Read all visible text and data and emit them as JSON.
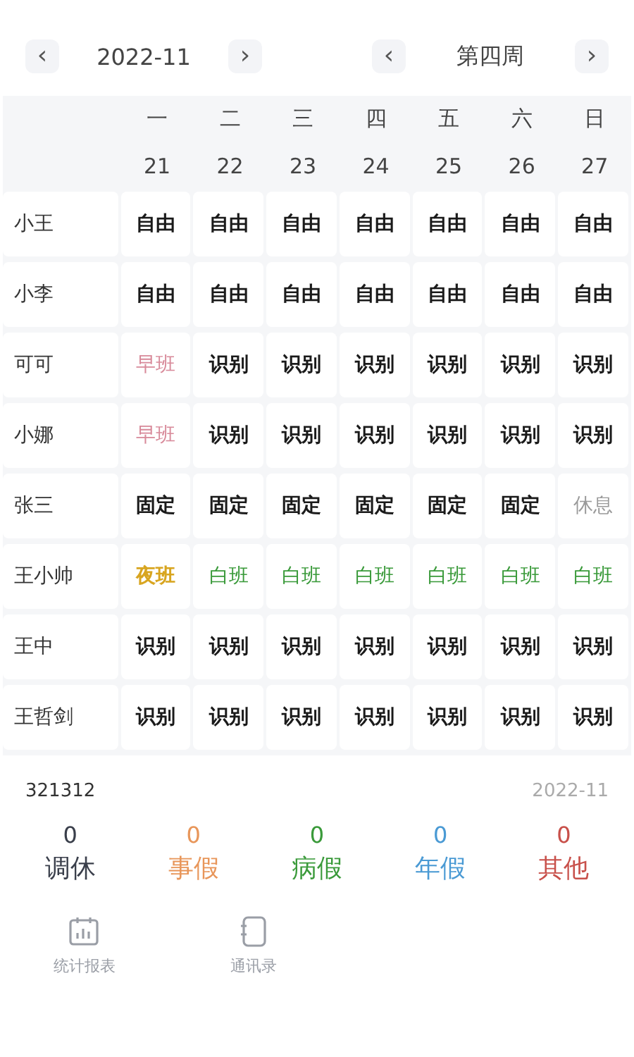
{
  "month_nav": {
    "prev": "‹",
    "label": "2022-11",
    "next": "›"
  },
  "week_nav": {
    "prev": "‹",
    "label": "第四周",
    "next": "›"
  },
  "weekdays": [
    "一",
    "二",
    "三",
    "四",
    "五",
    "六",
    "日"
  ],
  "dates": [
    "21",
    "22",
    "23",
    "24",
    "25",
    "26",
    "27"
  ],
  "rows": [
    {
      "name": "小王",
      "cells": [
        {
          "text": "自由",
          "kind": "normal"
        },
        {
          "text": "自由",
          "kind": "normal"
        },
        {
          "text": "自由",
          "kind": "normal"
        },
        {
          "text": "自由",
          "kind": "normal"
        },
        {
          "text": "自由",
          "kind": "normal"
        },
        {
          "text": "自由",
          "kind": "normal"
        },
        {
          "text": "自由",
          "kind": "normal"
        }
      ]
    },
    {
      "name": "小李",
      "cells": [
        {
          "text": "自由",
          "kind": "normal"
        },
        {
          "text": "自由",
          "kind": "normal"
        },
        {
          "text": "自由",
          "kind": "normal"
        },
        {
          "text": "自由",
          "kind": "normal"
        },
        {
          "text": "自由",
          "kind": "normal"
        },
        {
          "text": "自由",
          "kind": "normal"
        },
        {
          "text": "自由",
          "kind": "normal"
        }
      ]
    },
    {
      "name": "可可",
      "cells": [
        {
          "text": "早班",
          "kind": "morning"
        },
        {
          "text": "识别",
          "kind": "normal"
        },
        {
          "text": "识别",
          "kind": "normal"
        },
        {
          "text": "识别",
          "kind": "normal"
        },
        {
          "text": "识别",
          "kind": "normal"
        },
        {
          "text": "识别",
          "kind": "normal"
        },
        {
          "text": "识别",
          "kind": "normal"
        }
      ]
    },
    {
      "name": "小娜",
      "cells": [
        {
          "text": "早班",
          "kind": "morning"
        },
        {
          "text": "识别",
          "kind": "normal"
        },
        {
          "text": "识别",
          "kind": "normal"
        },
        {
          "text": "识别",
          "kind": "normal"
        },
        {
          "text": "识别",
          "kind": "normal"
        },
        {
          "text": "识别",
          "kind": "normal"
        },
        {
          "text": "识别",
          "kind": "normal"
        }
      ]
    },
    {
      "name": "张三",
      "cells": [
        {
          "text": "固定",
          "kind": "normal"
        },
        {
          "text": "固定",
          "kind": "normal"
        },
        {
          "text": "固定",
          "kind": "normal"
        },
        {
          "text": "固定",
          "kind": "normal"
        },
        {
          "text": "固定",
          "kind": "normal"
        },
        {
          "text": "固定",
          "kind": "normal"
        },
        {
          "text": "休息",
          "kind": "rest"
        }
      ]
    },
    {
      "name": "王小帅",
      "cells": [
        {
          "text": "夜班",
          "kind": "night"
        },
        {
          "text": "白班",
          "kind": "day"
        },
        {
          "text": "白班",
          "kind": "day"
        },
        {
          "text": "白班",
          "kind": "day"
        },
        {
          "text": "白班",
          "kind": "day"
        },
        {
          "text": "白班",
          "kind": "day"
        },
        {
          "text": "白班",
          "kind": "day"
        }
      ]
    },
    {
      "name": "王中",
      "cells": [
        {
          "text": "识别",
          "kind": "normal"
        },
        {
          "text": "识别",
          "kind": "normal"
        },
        {
          "text": "识别",
          "kind": "normal"
        },
        {
          "text": "识别",
          "kind": "normal"
        },
        {
          "text": "识别",
          "kind": "normal"
        },
        {
          "text": "识别",
          "kind": "normal"
        },
        {
          "text": "识别",
          "kind": "normal"
        }
      ]
    },
    {
      "name": "王哲剑",
      "cells": [
        {
          "text": "识别",
          "kind": "normal"
        },
        {
          "text": "识别",
          "kind": "normal"
        },
        {
          "text": "识别",
          "kind": "normal"
        },
        {
          "text": "识别",
          "kind": "normal"
        },
        {
          "text": "识别",
          "kind": "normal"
        },
        {
          "text": "识别",
          "kind": "normal"
        },
        {
          "text": "识别",
          "kind": "normal"
        }
      ]
    }
  ],
  "summary": {
    "user": "321312",
    "month": "2022-11"
  },
  "stats": [
    {
      "count": "0",
      "label": "调休",
      "color": "#3a3f4b"
    },
    {
      "count": "0",
      "label": "事假",
      "color": "#e8965a"
    },
    {
      "count": "0",
      "label": "病假",
      "color": "#3a9a3a"
    },
    {
      "count": "0",
      "label": "年假",
      "color": "#4a9ad4"
    },
    {
      "count": "0",
      "label": "其他",
      "color": "#c8504a"
    }
  ],
  "tabbar": [
    {
      "label": "统计报表",
      "kind": "report"
    },
    {
      "label": "通讯录",
      "kind": "contacts"
    }
  ]
}
